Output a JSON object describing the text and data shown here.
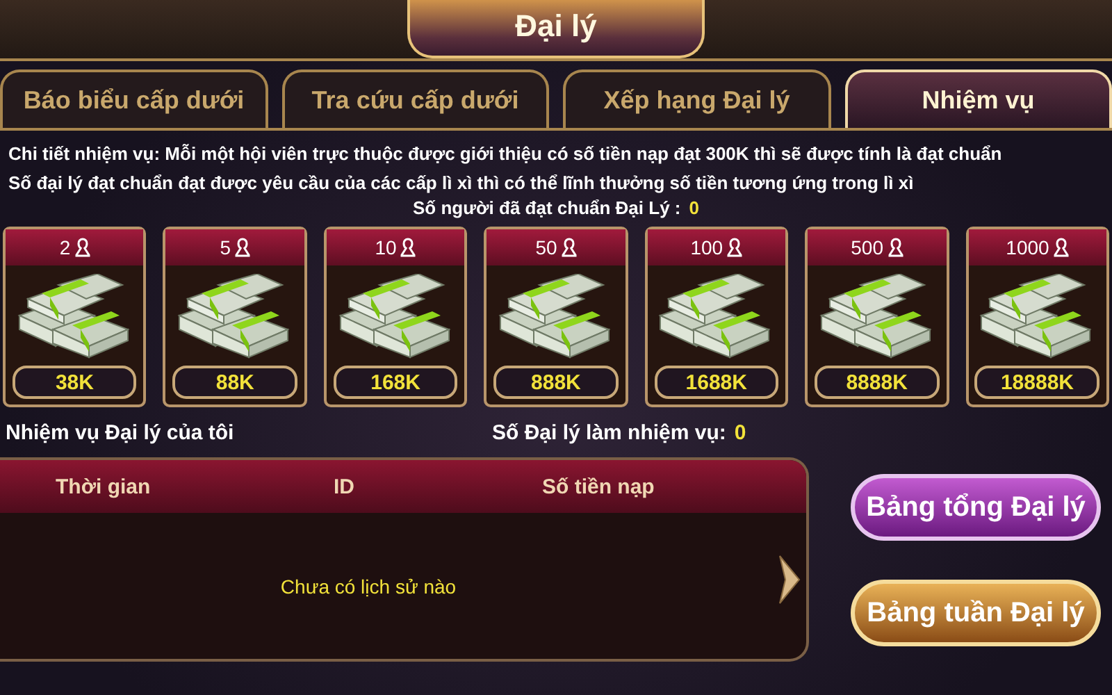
{
  "window": {
    "title": "Đại lý"
  },
  "tabs": [
    {
      "label": "Báo biểu cấp dưới",
      "selected": false
    },
    {
      "label": "Tra cứu cấp dưới",
      "selected": false
    },
    {
      "label": "Xếp hạng Đại lý",
      "selected": false
    },
    {
      "label": "Nhiệm vụ",
      "selected": true
    }
  ],
  "description": [
    "Chi tiết nhiệm vụ: Mỗi một hội viên trực thuộc được giới thiệu có số tiền nạp đạt 300K thì sẽ được tính là đạt chuẩn",
    "Số đại lý đạt chuẩn đạt được yêu cầu của các cấp lì xì thì có thể lĩnh thưởng số tiền tương ứng trong lì xì"
  ],
  "qualified": {
    "label": "Số người đã đạt chuẩn Đại Lý :",
    "value": "0"
  },
  "rewards": [
    {
      "count": "2",
      "amount": "38K"
    },
    {
      "count": "5",
      "amount": "88K"
    },
    {
      "count": "10",
      "amount": "168K"
    },
    {
      "count": "50",
      "amount": "888K"
    },
    {
      "count": "100",
      "amount": "1688K"
    },
    {
      "count": "500",
      "amount": "8888K"
    },
    {
      "count": "1000",
      "amount": "18888K"
    }
  ],
  "my_tasks": {
    "label": "Nhiệm vụ Đại lý của tôi"
  },
  "agents_count": {
    "label": "Số Đại lý làm nhiệm vụ:",
    "value": "0"
  },
  "table": {
    "columns": [
      "Thời gian",
      "ID",
      "Số tiền nạp"
    ],
    "empty": "Chưa có lịch sử nào"
  },
  "buttons": [
    {
      "label": "Bảng tổng Đại lý",
      "kind": "purple"
    },
    {
      "label": "Bảng tuần Đại lý",
      "kind": "gold"
    }
  ]
}
